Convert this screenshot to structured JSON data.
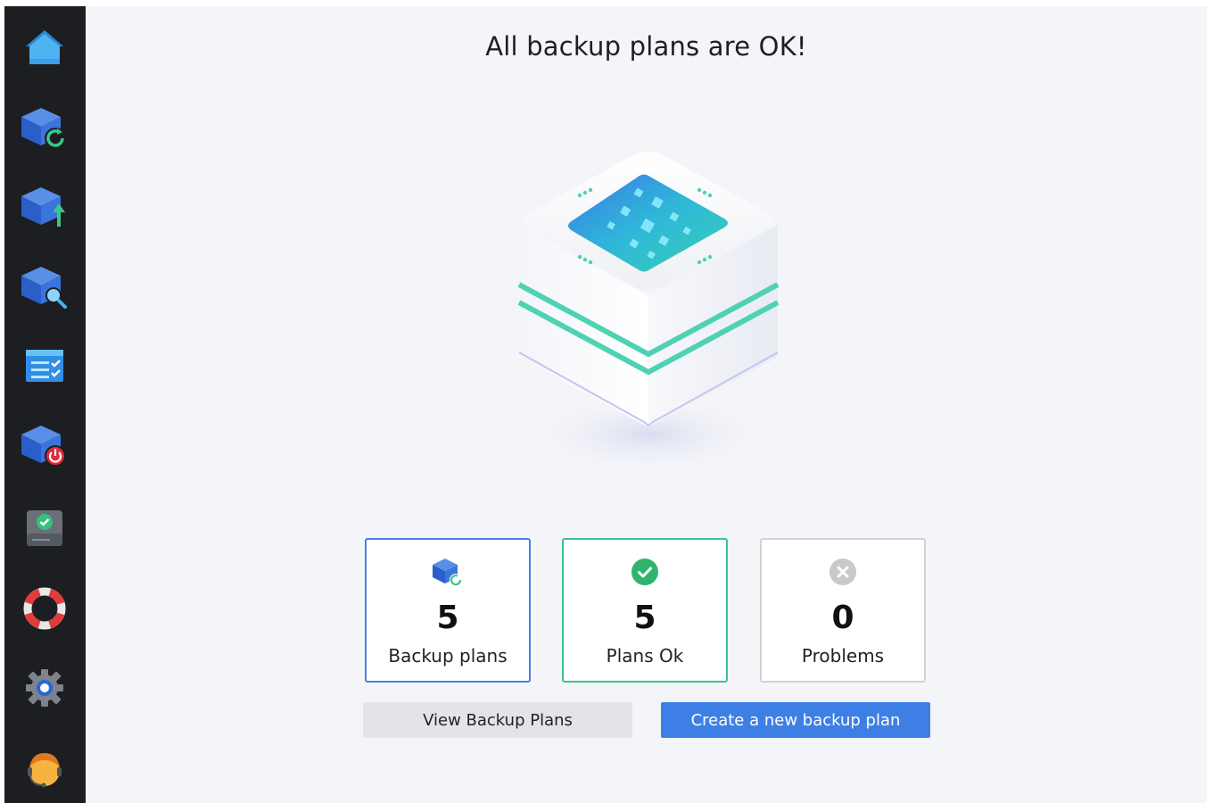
{
  "sidebar": {
    "items": [
      {
        "icon": "home-icon"
      },
      {
        "icon": "backup-sync-icon"
      },
      {
        "icon": "backup-upload-icon"
      },
      {
        "icon": "backup-search-icon"
      },
      {
        "icon": "task-list-icon"
      },
      {
        "icon": "backup-power-icon"
      },
      {
        "icon": "drive-check-icon"
      },
      {
        "icon": "lifebuoy-icon"
      },
      {
        "icon": "gear-icon"
      },
      {
        "icon": "support-agent-icon"
      }
    ]
  },
  "main": {
    "title": "All backup plans are OK!",
    "stats": [
      {
        "count": "5",
        "label": "Backup plans",
        "icon": "backup-plan-icon",
        "accent": "#4a7fe0"
      },
      {
        "count": "5",
        "label": "Plans Ok",
        "icon": "check-circle-icon",
        "accent": "#3cc197"
      },
      {
        "count": "0",
        "label": "Problems",
        "icon": "x-circle-icon",
        "accent": "#c9c9c9"
      }
    ],
    "buttons": {
      "view": "View Backup Plans",
      "create": "Create a new backup plan"
    }
  },
  "colors": {
    "sidebar_bg": "#1d1e22",
    "main_bg": "#f4f5f8",
    "primary": "#3e7fe6",
    "success": "#2fb46e",
    "secondary_btn": "#e3e4e9"
  }
}
